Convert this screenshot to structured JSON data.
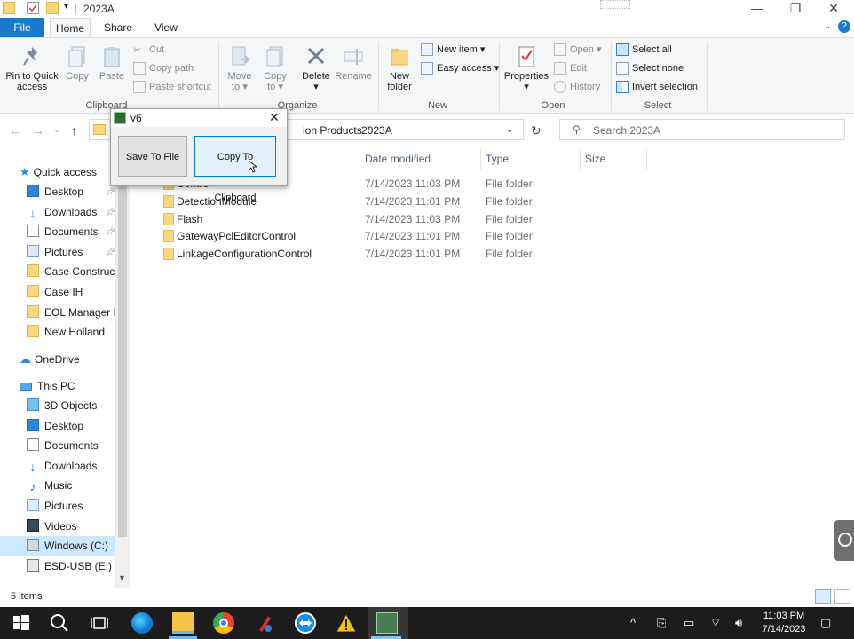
{
  "window": {
    "title": "2023A",
    "ribbon_tabs": [
      "File",
      "Home",
      "Share",
      "View"
    ],
    "help_icon": "help-icon"
  },
  "ribbon": {
    "clipboard": {
      "pin_label_line1": "Pin to Quick",
      "pin_label_line2": "access",
      "copy_label": "Copy",
      "paste_label": "Paste",
      "cut_label": "Cut",
      "copy_path_label": "Copy path",
      "paste_shortcut_label": "Paste shortcut",
      "group_label": "Clipboard"
    },
    "organize": {
      "move_to_line1": "Move",
      "move_to_line2": "to",
      "copy_to_line1": "Copy",
      "copy_to_line2": "to",
      "delete_label": "Delete",
      "rename_label": "Rename",
      "group_label": "Organize"
    },
    "new": {
      "new_folder_line1": "New",
      "new_folder_line2": "folder",
      "new_item_label": "New item",
      "easy_access_label": "Easy access",
      "group_label": "New"
    },
    "open": {
      "properties_label": "Properties",
      "open_label": "Open",
      "edit_label": "Edit",
      "history_label": "History",
      "group_label": "Open"
    },
    "select": {
      "select_all_label": "Select all",
      "select_none_label": "Select none",
      "invert_selection_label": "Invert selection",
      "group_label": "Select"
    }
  },
  "address": {
    "path_visible_1": "ion Products",
    "path_visible_2": "2023A",
    "search_placeholder": "Search 2023A"
  },
  "nav": {
    "quick_access": "Quick access",
    "items": [
      {
        "label": "Desktop",
        "icon": "desktop-icon",
        "pinned": true
      },
      {
        "label": "Downloads",
        "icon": "download-icon",
        "pinned": true
      },
      {
        "label": "Documents",
        "icon": "documents-icon",
        "pinned": true
      },
      {
        "label": "Pictures",
        "icon": "pictures-icon",
        "pinned": true
      },
      {
        "label": "Case Constructio",
        "icon": "folder-icon",
        "pinned": false
      },
      {
        "label": "Case IH",
        "icon": "folder-icon",
        "pinned": false
      },
      {
        "label": "EOL Manager M",
        "icon": "folder-icon",
        "pinned": false
      },
      {
        "label": "New Holland",
        "icon": "folder-icon",
        "pinned": false
      }
    ],
    "onedrive": "OneDrive",
    "this_pc": "This PC",
    "pc_items": [
      {
        "label": "3D Objects",
        "icon": "3d-objects-icon"
      },
      {
        "label": "Desktop",
        "icon": "desktop-icon"
      },
      {
        "label": "Documents",
        "icon": "documents-icon"
      },
      {
        "label": "Downloads",
        "icon": "download-icon"
      },
      {
        "label": "Music",
        "icon": "music-icon"
      },
      {
        "label": "Pictures",
        "icon": "pictures-icon"
      },
      {
        "label": "Videos",
        "icon": "videos-icon"
      },
      {
        "label": "Windows (C:)",
        "icon": "drive-icon",
        "selected": true
      },
      {
        "label": "ESD-USB (E:)",
        "icon": "usb-drive-icon"
      }
    ]
  },
  "columns": {
    "date_modified": "Date modified",
    "type": "Type",
    "size": "Size"
  },
  "files": [
    {
      "name": "Control",
      "date": "7/14/2023 11:03 PM",
      "type": "File folder"
    },
    {
      "name": "DetectionModule",
      "date": "7/14/2023 11:01 PM",
      "type": "File folder"
    },
    {
      "name": "Flash",
      "date": "7/14/2023 11:03 PM",
      "type": "File folder"
    },
    {
      "name": "GatewayPclEditorControl",
      "date": "7/14/2023 11:01 PM",
      "type": "File folder"
    },
    {
      "name": "LinkageConfigurationControl",
      "date": "7/14/2023 11:01 PM",
      "type": "File folder"
    }
  ],
  "status": {
    "items_count": "5 items"
  },
  "dialog": {
    "title": "v6",
    "save_button": "Save To File",
    "copy_button": "Copy To Clipboard"
  },
  "taskbar": {
    "time": "11:03 PM",
    "date": "7/14/2023"
  },
  "colors": {
    "accent": "#1979ca",
    "selection": "#cce8ff",
    "folder": "#f9d77e",
    "taskbar": "#1c1c1c"
  }
}
